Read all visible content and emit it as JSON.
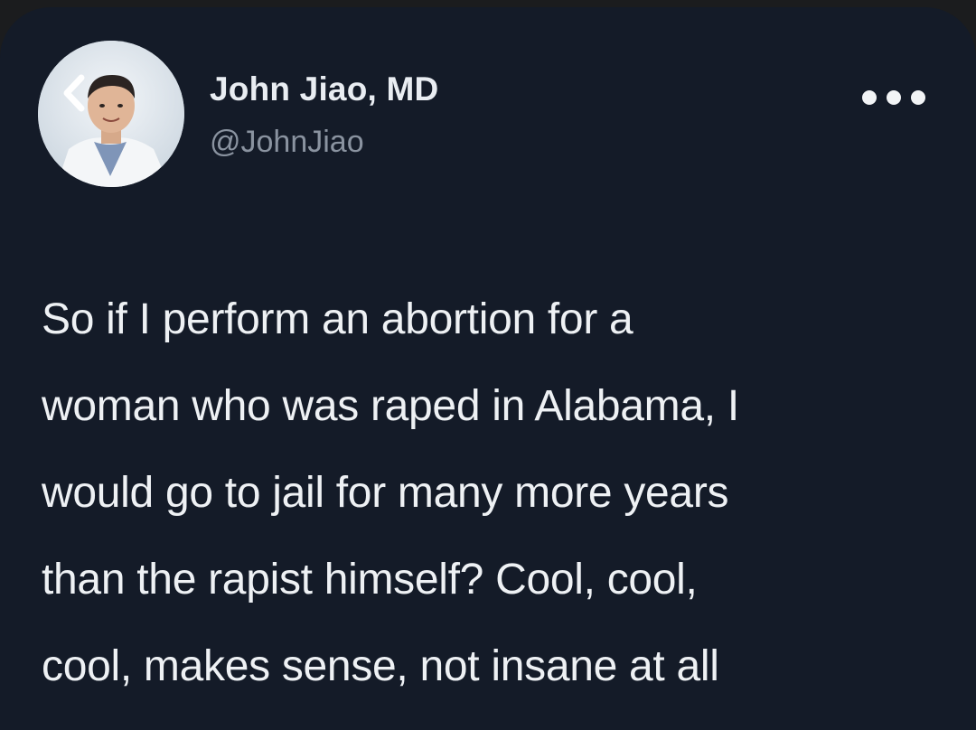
{
  "tweet": {
    "author": {
      "display_name": "John Jiao, MD",
      "handle": "@JohnJiao"
    },
    "text": "So if I perform an abortion for a\nwoman who was raped in Alabama, I\nwould go to jail for many more years\nthan the rapist himself? Cool, cool,\ncool, makes sense, not insane at all"
  },
  "icons": {
    "back": "chevron-left-icon",
    "more": "more-horizontal-icon"
  },
  "colors": {
    "background": "#141b28",
    "text": "#eef1f4",
    "handle": "#8a93a0"
  }
}
